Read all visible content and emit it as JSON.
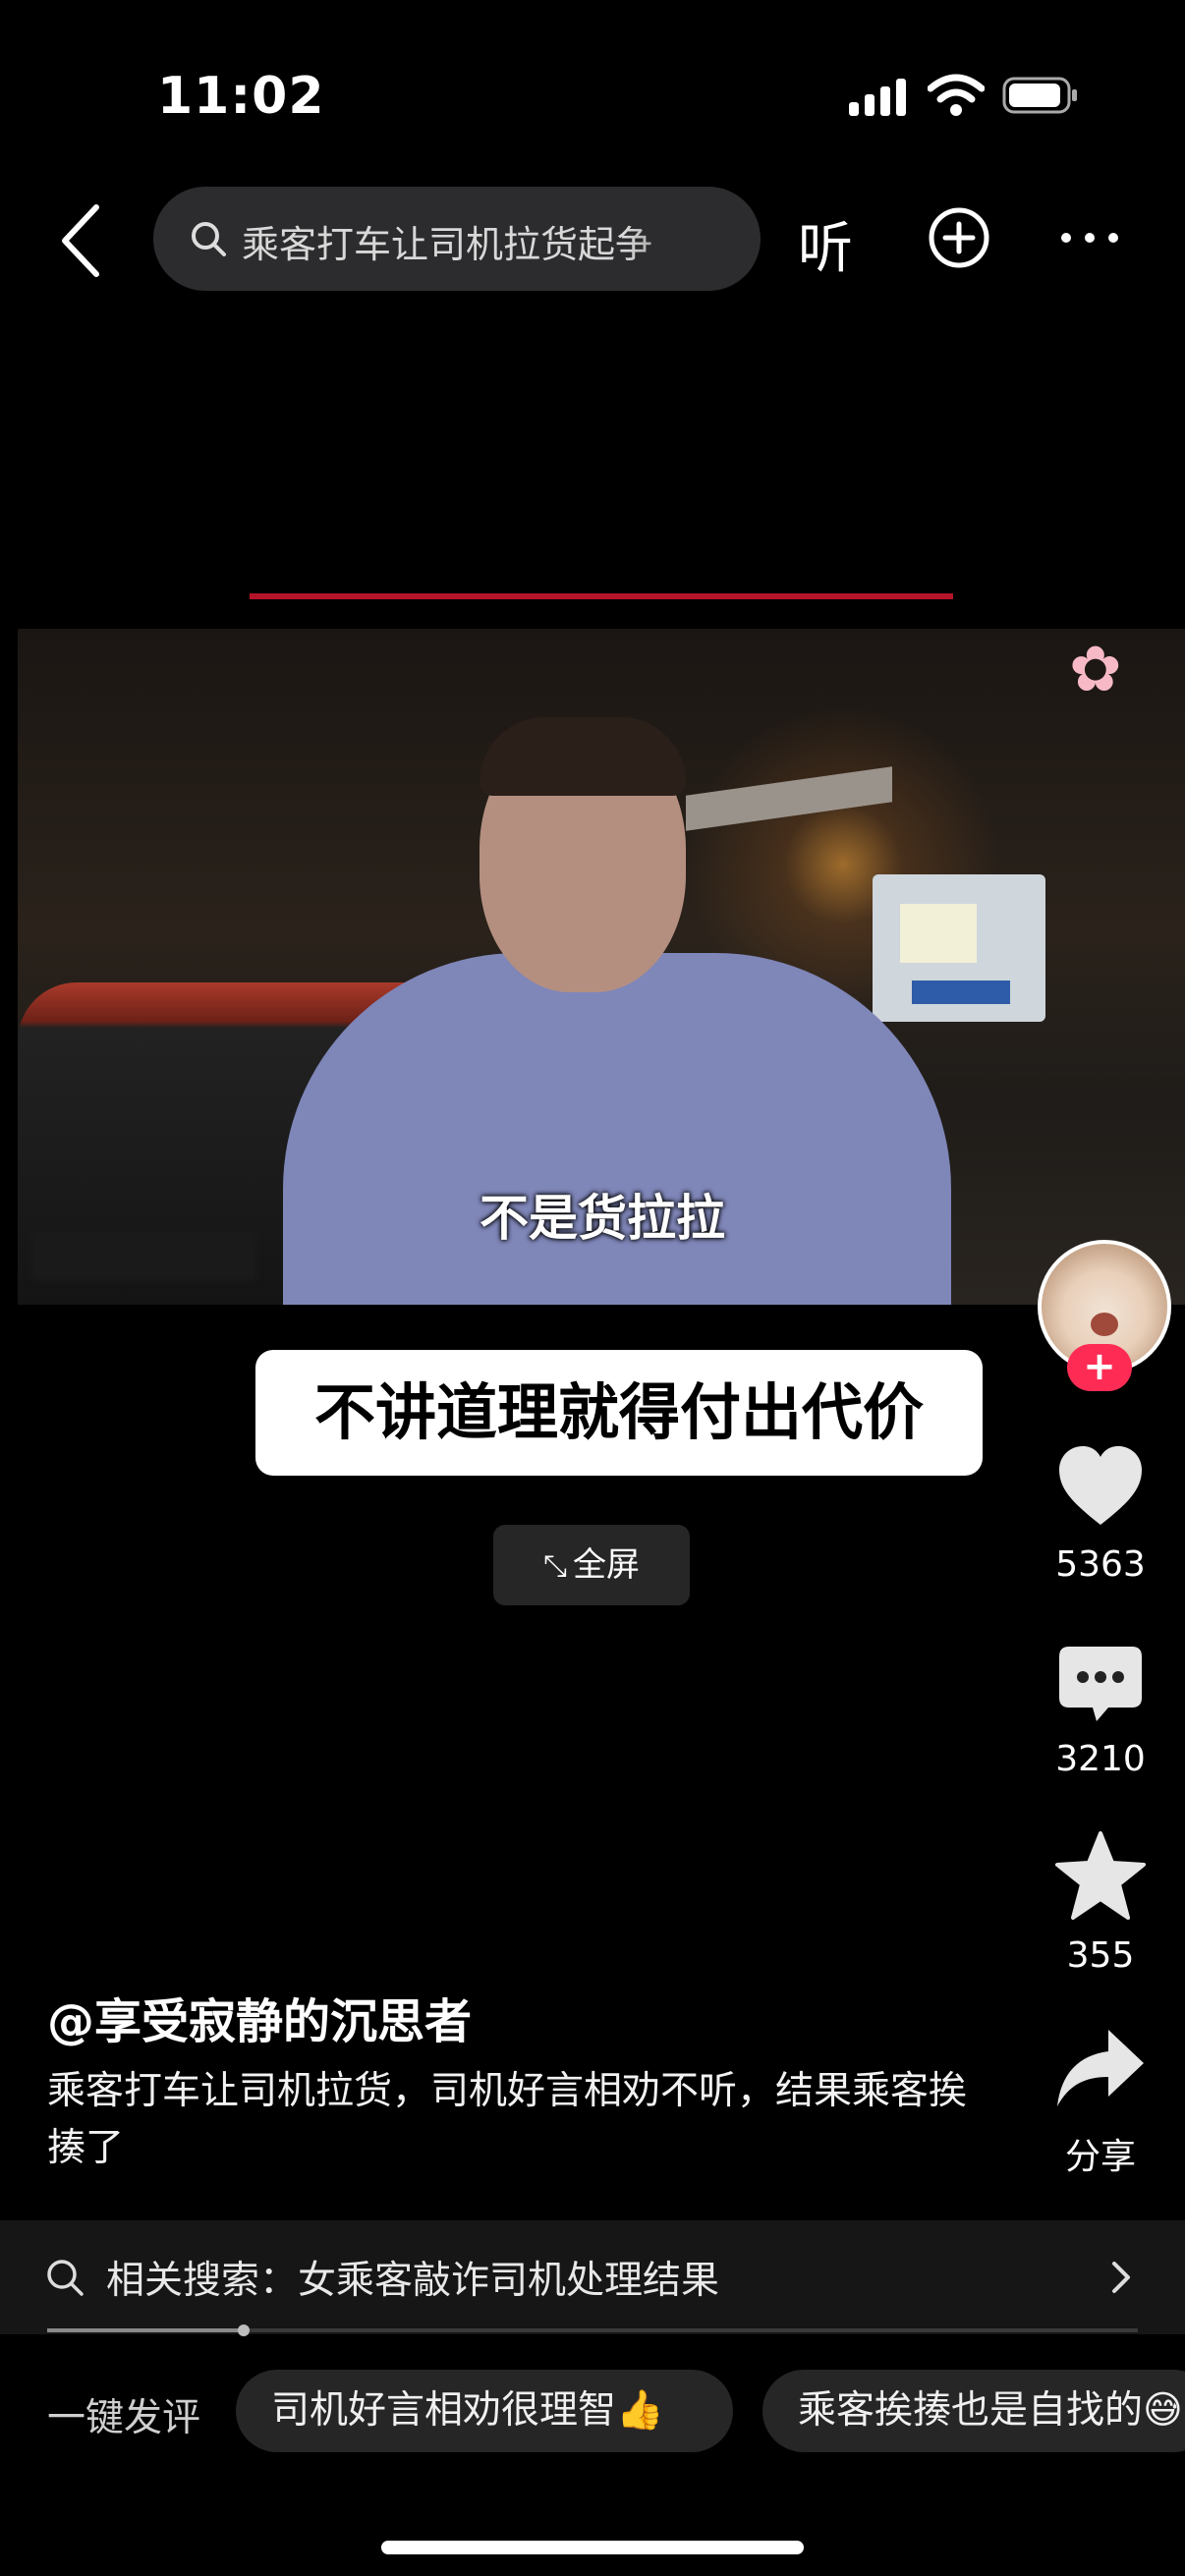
{
  "status_bar": {
    "time": "11:02"
  },
  "top_bar": {
    "search_text": "乘客打车让司机拉货起争",
    "listen_label": "听"
  },
  "video": {
    "subtitle": "不是货拉拉",
    "caption": "不讲道理就得付出代价",
    "fullscreen_label": "全屏",
    "fullscreen_icon": "⤡"
  },
  "rail": {
    "follow_symbol": "+",
    "likes": "5363",
    "comments": "3210",
    "favorites": "355",
    "share_label": "分享"
  },
  "post": {
    "author": "@享受寂静的沉思者",
    "description": "乘客打车让司机拉货，司机好言相劝不听，结果乘客挨揍了"
  },
  "related": {
    "text": "相关搜索：女乘客敲诈司机处理结果"
  },
  "playback": {
    "progress": 0.18
  },
  "quick_comment": {
    "label": "一键发评",
    "chips": [
      "司机好言相劝很理智👍",
      "乘客挨揍也是自找的😅"
    ]
  },
  "colors": {
    "accent": "#fe2c55",
    "background": "#000000"
  }
}
